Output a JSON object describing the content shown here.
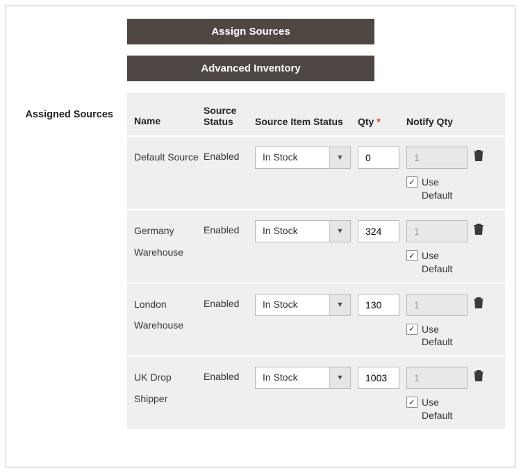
{
  "buttons": {
    "assign_sources": "Assign Sources",
    "advanced_inventory": "Advanced Inventory"
  },
  "section_label": "Assigned Sources",
  "columns": {
    "name": "Name",
    "source_status": "Source Status",
    "source_item_status": "Source Item Status",
    "qty": "Qty",
    "notify_qty": "Notify Qty"
  },
  "labels": {
    "use_default": "Use Default",
    "required_mark": "*",
    "checkbox_checked": "✓",
    "caret": "▼"
  },
  "rows": [
    {
      "name": "Default Source",
      "source_status": "Enabled",
      "source_item_status": "In Stock",
      "qty": "0",
      "notify_qty": "1",
      "use_default_checked": true
    },
    {
      "name": "Germany Warehouse",
      "source_status": "Enabled",
      "source_item_status": "In Stock",
      "qty": "324",
      "notify_qty": "1",
      "use_default_checked": true
    },
    {
      "name": "London Warehouse",
      "source_status": "Enabled",
      "source_item_status": "In Stock",
      "qty": "130",
      "notify_qty": "1",
      "use_default_checked": true
    },
    {
      "name": "UK Drop Shipper",
      "source_status": "Enabled",
      "source_item_status": "In Stock",
      "qty": "1003",
      "notify_qty": "1",
      "use_default_checked": true
    }
  ]
}
